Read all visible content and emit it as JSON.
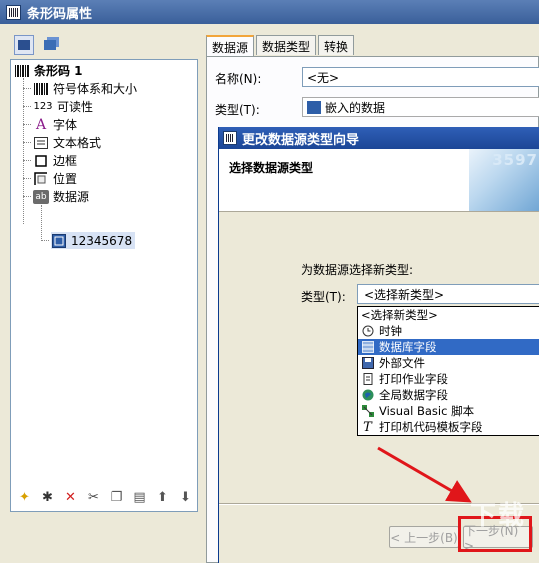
{
  "window": {
    "title": "条形码属性"
  },
  "left_toolbar": {
    "icons": [
      "structure-icon",
      "layers-icon"
    ]
  },
  "tree": {
    "root": {
      "label": "条形码 1",
      "icon": "barcode-icon"
    },
    "items": [
      {
        "label": "符号体系和大小",
        "icon": "barcode-bars-icon"
      },
      {
        "label": "可读性",
        "icon_text": "123"
      },
      {
        "label": "字体",
        "icon_text": "A"
      },
      {
        "label": "文本格式",
        "icon": "text-format-icon"
      },
      {
        "label": "边框",
        "icon": "border-icon"
      },
      {
        "label": "位置",
        "icon": "position-icon"
      },
      {
        "label": "数据源",
        "icon_text": "ab"
      }
    ],
    "child": {
      "label": "12345678",
      "icon": "data-icon"
    }
  },
  "bottom_toolbar": [
    "new-icon",
    "wand-icon",
    "delete-icon",
    "cut-icon",
    "copy-icon",
    "paste-icon",
    "up-arrow-icon",
    "down-arrow-icon"
  ],
  "tabs": [
    {
      "label": "数据源",
      "active": true
    },
    {
      "label": "数据类型",
      "active": false
    },
    {
      "label": "转换",
      "active": false
    }
  ],
  "form": {
    "name_label": "名称(N):",
    "name_value": "<无>",
    "type_label": "类型(T):",
    "type_value": "嵌入的数据"
  },
  "wizard": {
    "title": "更改数据源类型向导",
    "header": "选择数据源类型",
    "header_deco": "3597",
    "prompt": "为数据源选择新类型:",
    "type_label": "类型(T):",
    "combo_value": "<选择新类型>",
    "options": [
      {
        "label": "<选择新类型>",
        "icon": "",
        "selected": false
      },
      {
        "label": "时钟",
        "icon": "clock-icon",
        "selected": false
      },
      {
        "label": "数据库字段",
        "icon": "database-icon",
        "selected": true
      },
      {
        "label": "外部文件",
        "icon": "file-icon",
        "selected": false
      },
      {
        "label": "打印作业字段",
        "icon": "print-job-icon",
        "selected": false
      },
      {
        "label": "全局数据字段",
        "icon": "globe-icon",
        "selected": false
      },
      {
        "label": "Visual Basic 脚本",
        "icon": "vb-script-icon",
        "selected": false
      },
      {
        "label": "打印机代码模板字段",
        "icon": "printer-code-icon",
        "selected": false
      }
    ],
    "back_label": "< 上一步(B)",
    "next_label": "下一步(N) >"
  },
  "watermark": "下载"
}
